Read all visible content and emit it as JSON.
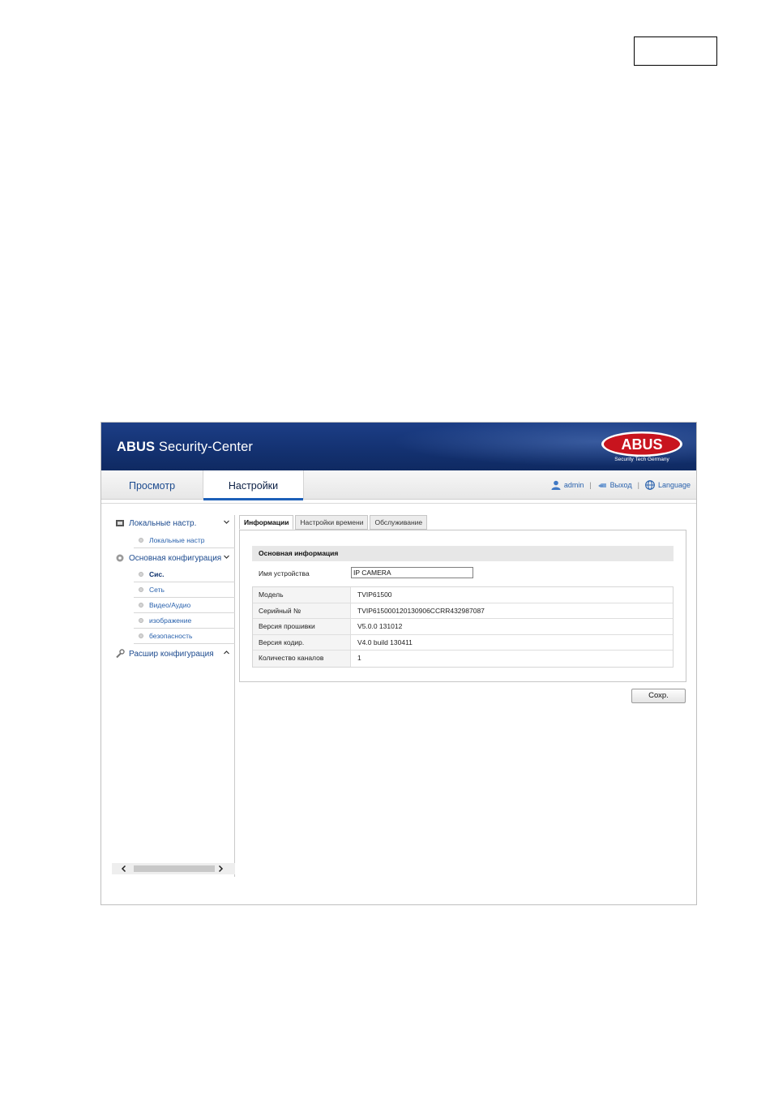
{
  "app": {
    "brand_bold": "ABUS",
    "brand_rest": " Security-Center",
    "logo_text": "ABUS",
    "logo_tagline": "Security Tech Germany"
  },
  "nav": {
    "tabs": [
      {
        "label": "Просмотр",
        "active": false
      },
      {
        "label": "Настройки",
        "active": true
      }
    ]
  },
  "userbar": {
    "user": "admin",
    "logout": "Выход",
    "language": "Language"
  },
  "sidebar": {
    "sections": [
      {
        "label": "Локальные настр.",
        "icon": "local-settings-icon",
        "expanded": true,
        "items": [
          {
            "label": "Локальные настр",
            "active": false
          }
        ]
      },
      {
        "label": "Основная конфигурация",
        "icon": "basic-config-icon",
        "expanded": true,
        "items": [
          {
            "label": "Сис.",
            "active": true
          },
          {
            "label": "Сеть",
            "active": false
          },
          {
            "label": "Видео/Аудио",
            "active": false
          },
          {
            "label": "изображение",
            "active": false
          },
          {
            "label": "безопасность",
            "active": false
          }
        ]
      },
      {
        "label": "Расшир конфигурация",
        "icon": "wrench-icon",
        "expanded": false,
        "items": []
      }
    ]
  },
  "tabs": [
    {
      "label": "Информации",
      "active": true
    },
    {
      "label": "Настройки времени",
      "active": false
    },
    {
      "label": "Обслуживание",
      "active": false
    }
  ],
  "panel": {
    "title": "Основная информация",
    "device_name_label": "Имя устройства",
    "device_name_value": "IP CAMERA",
    "rows": [
      {
        "label": "Модель",
        "value": "TVIP61500"
      },
      {
        "label": "Серийный №",
        "value": "TVIP615000120130906CCRR432987087"
      },
      {
        "label": "Версия прошивки",
        "value": "V5.0.0 131012"
      },
      {
        "label": "Версия кодир.",
        "value": "V4.0 build 130411"
      },
      {
        "label": "Количество каналов",
        "value": "1"
      }
    ]
  },
  "save_label": "Сохр.",
  "colors": {
    "banner": "#143272",
    "nav_text": "#1d4b8f",
    "link": "#2a62ad",
    "logo_red": "#c8141e"
  }
}
